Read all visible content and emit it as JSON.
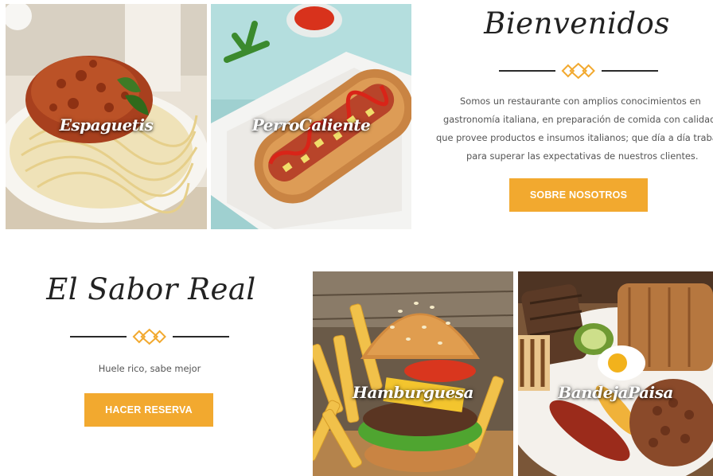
{
  "colors": {
    "accent": "#f2a92f",
    "heading": "#222222",
    "text": "#555555"
  },
  "welcome": {
    "title": "Bienvenidos",
    "lines": [
      "Somos un restaurante con amplios conocimientos en",
      "gastronomía italiana, en preparación de comida con calidad,",
      "que provee productos e insumos italianos; que día a día trabaja",
      "para superar las expectativas de nuestros clientes."
    ],
    "button": "SOBRE NOSOTROS"
  },
  "sabor": {
    "title": "El Sabor Real",
    "tagline": "Huele rico, sabe mejor",
    "button": "HACER RESERVA"
  },
  "dishes": [
    {
      "label": "Espaguetis",
      "image": "spaghetti-photo"
    },
    {
      "label": "PerroCaliente",
      "image": "hotdog-photo"
    },
    {
      "label": "Hamburguesa",
      "image": "burger-photo"
    },
    {
      "label": "BandejaPaisa",
      "image": "bandeja-paisa-photo"
    }
  ]
}
